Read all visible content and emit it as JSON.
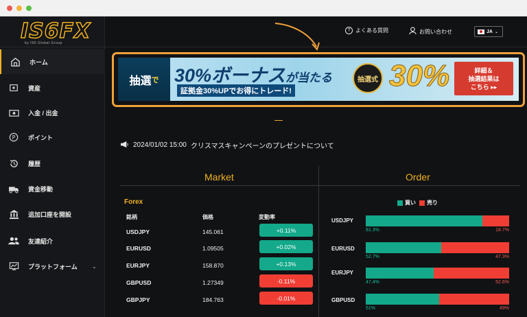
{
  "brand": {
    "logo": "IS6FX",
    "tagline": "by IS6 Global Group"
  },
  "sidebar": {
    "items": [
      {
        "label": "ホーム",
        "icon": "home-icon",
        "active": true
      },
      {
        "label": "資産",
        "icon": "wallet-icon"
      },
      {
        "label": "入金 / 出金",
        "icon": "cash-icon"
      },
      {
        "label": "ポイント",
        "icon": "points-icon"
      },
      {
        "label": "履歴",
        "icon": "history-icon"
      },
      {
        "label": "資金移動",
        "icon": "transfer-icon"
      },
      {
        "label": "追加口座を開設",
        "icon": "bank-icon"
      },
      {
        "label": "友達紹介",
        "icon": "friends-icon"
      },
      {
        "label": "プラットフォーム",
        "icon": "monitor-icon",
        "expandable": true
      }
    ]
  },
  "topbar": {
    "faq": "よくある質問",
    "contact": "お問い合わせ",
    "language": "JA"
  },
  "banner": {
    "lottery_prefix": "抽選",
    "lottery_suffix": "で",
    "headline_pct": "30%",
    "headline_rest": "ボーナス",
    "headline_tail": "が当たる",
    "sub": "証拠金30%UPでお得にトレード!",
    "badge": "抽選式",
    "big_number": "30%",
    "button_line1": "詳細＆",
    "button_line2": "抽選結果は",
    "button_line3": "こちら ▸▸"
  },
  "news": {
    "date": "2024/01/02 15:00",
    "title": "クリスマスキャンペーンのプレゼントについて"
  },
  "market": {
    "title": "Market",
    "category": "Forex",
    "headers": {
      "pair": "銘柄",
      "price": "価格",
      "change": "変動率"
    },
    "rows": [
      {
        "pair": "USDJPY",
        "price": "145.061",
        "change": "+0.11%",
        "dir": "up"
      },
      {
        "pair": "EURUSD",
        "price": "1.09505",
        "change": "+0.02%",
        "dir": "up"
      },
      {
        "pair": "EURJPY",
        "price": "158.870",
        "change": "+0.13%",
        "dir": "up"
      },
      {
        "pair": "GBPUSD",
        "price": "1.27349",
        "change": "-0.11%",
        "dir": "down"
      },
      {
        "pair": "GBPJPY",
        "price": "184.763",
        "change": "-0.01%",
        "dir": "down"
      }
    ]
  },
  "order": {
    "title": "Order",
    "legend_buy": "買い",
    "legend_sell": "売り",
    "colors": {
      "buy": "#13a98a",
      "sell": "#f03e35"
    },
    "rows": [
      {
        "pair": "USDJPY",
        "buy": "81.3%",
        "sell": "18.7%",
        "buy_value": 81.3
      },
      {
        "pair": "EURUSD",
        "buy": "52.7%",
        "sell": "47.3%",
        "buy_value": 52.7
      },
      {
        "pair": "EURJPY",
        "buy": "47.4%",
        "sell": "52.6%",
        "buy_value": 47.4
      },
      {
        "pair": "GBPUSD",
        "buy": "51%",
        "sell": "49%",
        "buy_value": 51
      }
    ]
  },
  "accent": "#f0b122"
}
